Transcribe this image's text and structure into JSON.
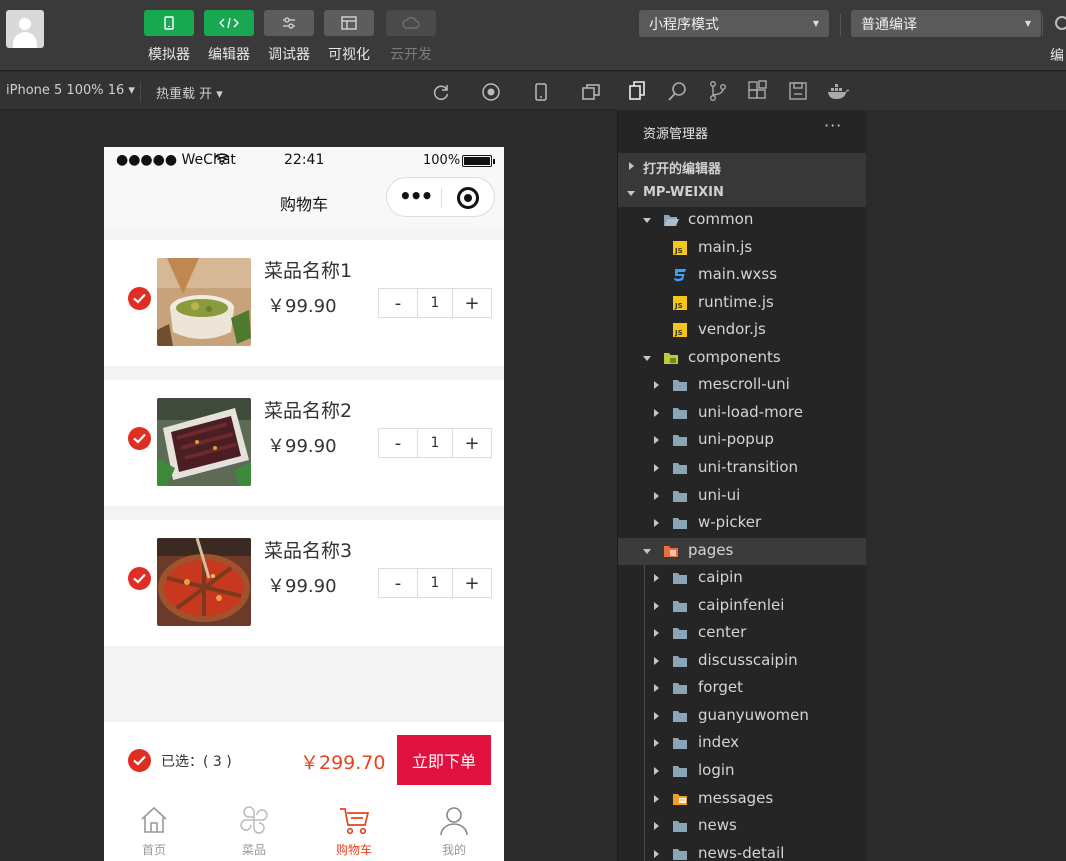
{
  "toolbar": {
    "tools": [
      {
        "label": "模拟器",
        "icon": "phone-icon"
      },
      {
        "label": "编辑器",
        "icon": "code-icon"
      },
      {
        "label": "调试器",
        "icon": "settings-icon"
      },
      {
        "label": "可视化",
        "icon": "layout-icon"
      },
      {
        "label": "云开发",
        "icon": "cloud-icon"
      }
    ],
    "mode_dropdown": "小程序模式",
    "compile_dropdown": "普通编译",
    "edge_label": "编"
  },
  "subbar": {
    "device": "iPhone 5 100% 16 ▾",
    "hot_reload": "热重载 开 ▾"
  },
  "phone": {
    "status": {
      "carrier": "●●●●● WeChat",
      "time": "22:41",
      "battery": "100%"
    },
    "nav_title": "购物车",
    "items": [
      {
        "name": "菜品名称1",
        "price": "￥99.90",
        "qty": "1"
      },
      {
        "name": "菜品名称2",
        "price": "￥99.90",
        "qty": "1"
      },
      {
        "name": "菜品名称3",
        "price": "￥99.90",
        "qty": "1"
      }
    ],
    "stepper": {
      "minus": "-",
      "plus": "+"
    },
    "footer": {
      "selected": "已选：( 3 )",
      "total": "￥299.70",
      "order_button": "立即下单"
    },
    "tabs": [
      {
        "label": "首页",
        "icon": "home-icon",
        "active": false
      },
      {
        "label": "菜品",
        "icon": "clover-icon",
        "active": false
      },
      {
        "label": "购物车",
        "icon": "cart-icon",
        "active": true
      },
      {
        "label": "我的",
        "icon": "user-icon",
        "active": false
      }
    ]
  },
  "explorer": {
    "title": "资源管理器",
    "more": "···",
    "open_editors": "打开的编辑器",
    "project": "MP-WEIXIN",
    "tree": [
      {
        "label": "common",
        "type": "folder-open",
        "level": 1,
        "open": true
      },
      {
        "label": "main.js",
        "type": "js",
        "level": 2
      },
      {
        "label": "main.wxss",
        "type": "css",
        "level": 2
      },
      {
        "label": "runtime.js",
        "type": "js",
        "level": 2
      },
      {
        "label": "vendor.js",
        "type": "js",
        "level": 2
      },
      {
        "label": "components",
        "type": "folder-components",
        "level": 1,
        "open": true
      },
      {
        "label": "mescroll-uni",
        "type": "folder",
        "level": 2
      },
      {
        "label": "uni-load-more",
        "type": "folder",
        "level": 2
      },
      {
        "label": "uni-popup",
        "type": "folder",
        "level": 2
      },
      {
        "label": "uni-transition",
        "type": "folder",
        "level": 2
      },
      {
        "label": "uni-ui",
        "type": "folder",
        "level": 2
      },
      {
        "label": "w-picker",
        "type": "folder",
        "level": 2
      },
      {
        "label": "pages",
        "type": "folder-pages",
        "level": 1,
        "open": true,
        "highlight": true
      },
      {
        "label": "caipin",
        "type": "folder",
        "level": 2
      },
      {
        "label": "caipinfenlei",
        "type": "folder",
        "level": 2
      },
      {
        "label": "center",
        "type": "folder",
        "level": 2
      },
      {
        "label": "discusscaipin",
        "type": "folder",
        "level": 2
      },
      {
        "label": "forget",
        "type": "folder",
        "level": 2
      },
      {
        "label": "guanyuwomen",
        "type": "folder",
        "level": 2
      },
      {
        "label": "index",
        "type": "folder",
        "level": 2
      },
      {
        "label": "login",
        "type": "folder",
        "level": 2
      },
      {
        "label": "messages",
        "type": "folder-messages",
        "level": 2
      },
      {
        "label": "news",
        "type": "folder",
        "level": 2
      },
      {
        "label": "news-detail",
        "type": "folder",
        "level": 2
      }
    ]
  },
  "colors": {
    "accent_green": "#17a851",
    "check_red": "#e02e24",
    "price_orange": "#e8431f",
    "order_red": "#e0103f"
  }
}
